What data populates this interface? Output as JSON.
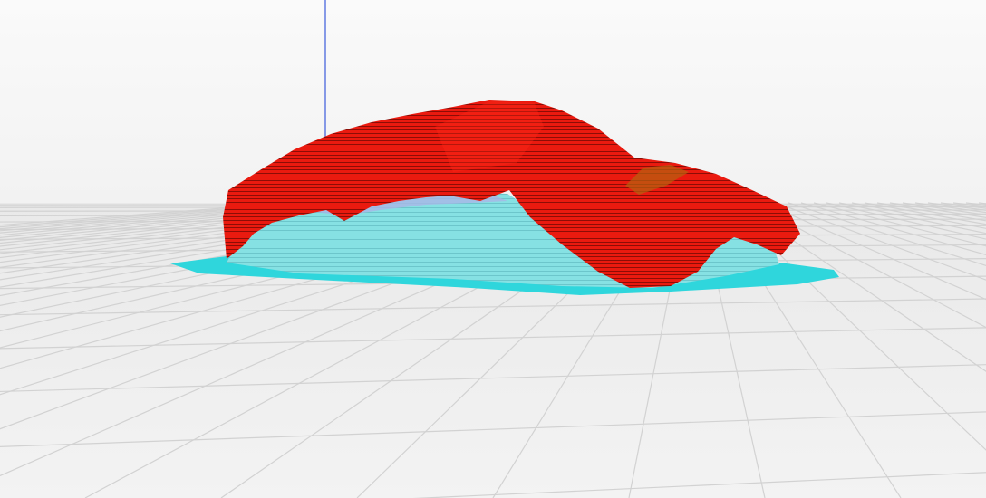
{
  "viewport": {
    "view": "layer-preview-3d",
    "colors": {
      "background": "#f7f7f7",
      "build_plate": "#ececec",
      "grid_line": "#d4d4d4",
      "axis_z": "#3b5bdb",
      "model_wall": "#e8180e",
      "support": "#7fe3e6",
      "adhesion": "#2fd6dc",
      "infill_hint": "#a8b7e8"
    },
    "icons": []
  }
}
